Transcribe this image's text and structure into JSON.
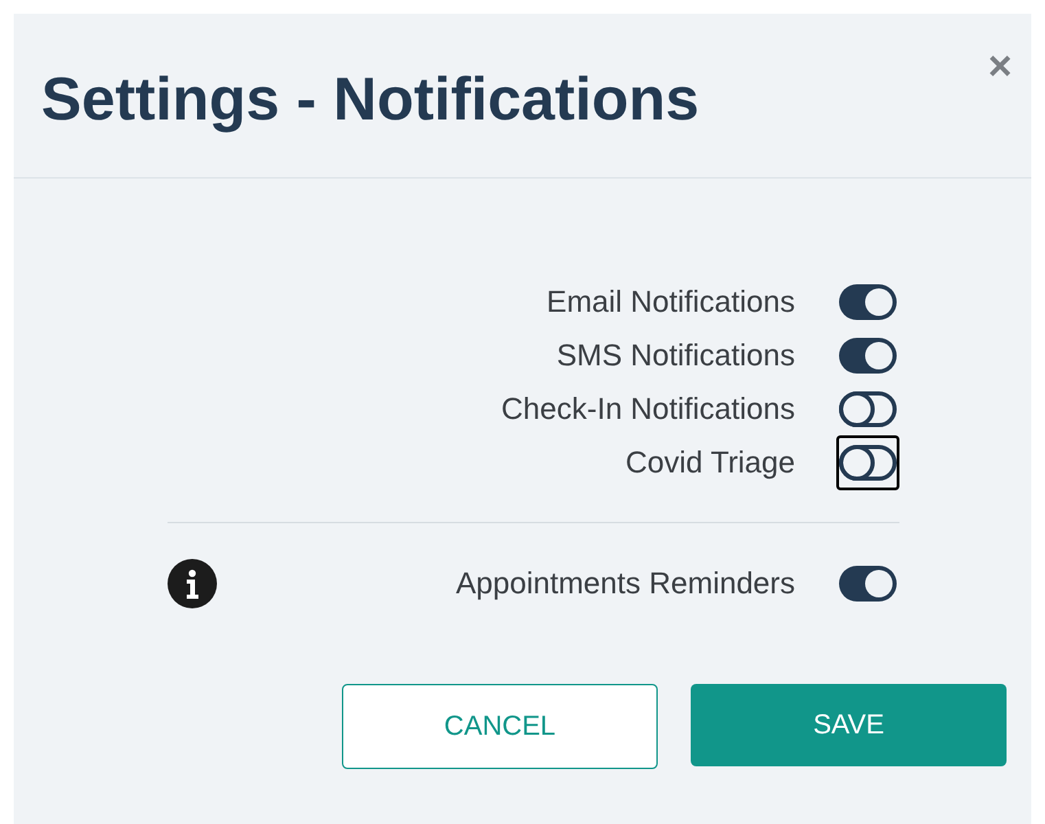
{
  "dialog": {
    "title": "Settings - Notifications",
    "close": "×"
  },
  "toggles": [
    {
      "label": "Email Notifications",
      "on": true,
      "focused": false
    },
    {
      "label": "SMS Notifications",
      "on": true,
      "focused": false
    },
    {
      "label": "Check-In Notifications",
      "on": false,
      "focused": false
    },
    {
      "label": "Covid Triage",
      "on": false,
      "focused": true
    }
  ],
  "reminder": {
    "label": "Appointments Reminders",
    "on": true,
    "focused": false
  },
  "buttons": [
    {
      "label": "CANCEL",
      "kind": "outline"
    },
    {
      "label": "SAVE",
      "kind": "primary"
    }
  ]
}
